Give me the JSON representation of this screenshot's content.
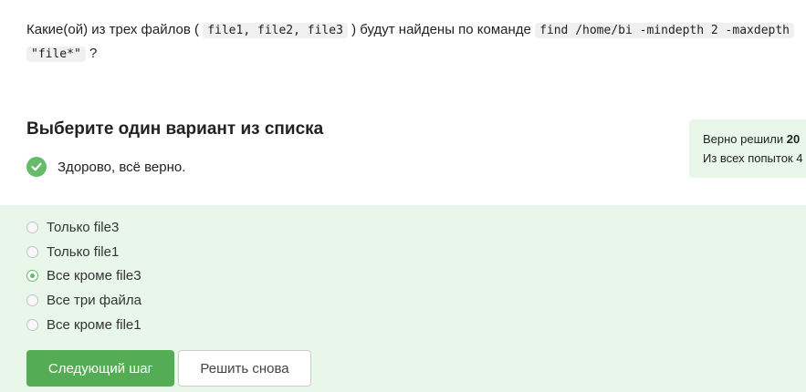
{
  "question": {
    "text_before": "Какие(ой) из трех файлов (",
    "files_code": "file1, file2, file3",
    "text_middle": ") будут найдены по команде",
    "command_code": "find /home/bi -mindepth 2 -maxdepth",
    "pattern_code": "\"file*\"",
    "text_end": "?"
  },
  "section_title": "Выберите один вариант из списка",
  "success_message": "Здорово, всё верно.",
  "stats": {
    "solved_label": "Верно решили",
    "solved_count": "20",
    "attempts_label": "Из всех попыток",
    "attempts_value": "4"
  },
  "options": [
    {
      "label": "Только file3",
      "selected": false
    },
    {
      "label": "Только file1",
      "selected": false
    },
    {
      "label": "Все кроме file3",
      "selected": true
    },
    {
      "label": "Все три файла",
      "selected": false
    },
    {
      "label": "Все кроме file1",
      "selected": false
    }
  ],
  "buttons": {
    "next_label": "Следующий шаг",
    "retry_label": "Решить снова"
  },
  "colors": {
    "accent_green": "#54ad54",
    "success_bg": "#e9f7ea",
    "check_green": "#66bb6a"
  }
}
